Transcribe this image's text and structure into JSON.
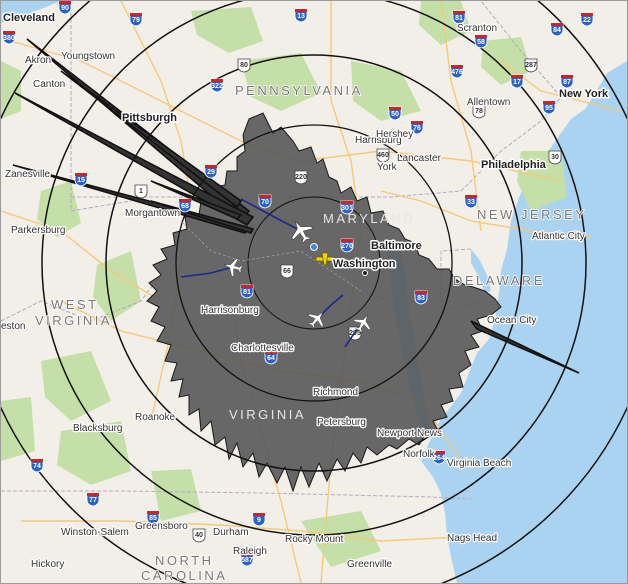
{
  "map": {
    "center_label": "Washington",
    "cities": [
      {
        "id": "cleveland",
        "name": "Cleveland",
        "major": true
      },
      {
        "id": "akron",
        "name": "Akron",
        "major": false
      },
      {
        "id": "youngstown",
        "name": "Youngstown",
        "major": false
      },
      {
        "id": "canton",
        "name": "Canton",
        "major": false
      },
      {
        "id": "pittsburgh",
        "name": "Pittsburgh",
        "major": true
      },
      {
        "id": "zanesville",
        "name": "Zanesville",
        "major": false
      },
      {
        "id": "morgantown",
        "name": "Morgantown",
        "major": false
      },
      {
        "id": "parkersburg",
        "name": "Parkersburg",
        "major": false
      },
      {
        "id": "scranton",
        "name": "Scranton",
        "major": false
      },
      {
        "id": "allentown",
        "name": "Allentown",
        "major": false
      },
      {
        "id": "new-york",
        "name": "New York",
        "major": true
      },
      {
        "id": "harrisburg",
        "name": "Harrisburg",
        "major": false
      },
      {
        "id": "hershey",
        "name": "Hershey",
        "major": false
      },
      {
        "id": "lancaster",
        "name": "Lancaster",
        "major": false
      },
      {
        "id": "york",
        "name": "York",
        "major": false
      },
      {
        "id": "philadelphia",
        "name": "Philadelphia",
        "major": true
      },
      {
        "id": "baltimore",
        "name": "Baltimore",
        "major": true
      },
      {
        "id": "washington",
        "name": "Washington",
        "major": true
      },
      {
        "id": "atlantic-city",
        "name": "Atlantic City",
        "major": false
      },
      {
        "id": "ocean-city",
        "name": "Ocean City",
        "major": false
      },
      {
        "id": "harrisonburg",
        "name": "Harrisonburg",
        "major": false
      },
      {
        "id": "charlottesville",
        "name": "Charlottesville",
        "major": false
      },
      {
        "id": "richmond",
        "name": "Richmond",
        "major": false
      },
      {
        "id": "petersburg",
        "name": "Petersburg",
        "major": false
      },
      {
        "id": "roanoke",
        "name": "Roanoke",
        "major": false
      },
      {
        "id": "blacksburg",
        "name": "Blacksburg",
        "major": false
      },
      {
        "id": "newport-news",
        "name": "Newport News",
        "major": false
      },
      {
        "id": "norfolk",
        "name": "Norfolk",
        "major": false
      },
      {
        "id": "virginia-beach",
        "name": "Virginia Beach",
        "major": false
      },
      {
        "id": "winston-salem",
        "name": "Winston-Salem",
        "major": false
      },
      {
        "id": "greensboro",
        "name": "Greensboro",
        "major": false
      },
      {
        "id": "durham",
        "name": "Durham",
        "major": false
      },
      {
        "id": "raleigh",
        "name": "Raleigh",
        "major": false
      },
      {
        "id": "rocky-mount",
        "name": "Rocky Mount",
        "major": false
      },
      {
        "id": "greenville",
        "name": "Greenville",
        "major": false
      },
      {
        "id": "hickory",
        "name": "Hickory",
        "major": false
      },
      {
        "id": "nags-head",
        "name": "Nags Head",
        "major": false
      },
      {
        "id": "charleston-partial",
        "name": "eston",
        "major": false
      }
    ],
    "states": [
      {
        "id": "pennsylvania",
        "name": "PENNSYLVANIA"
      },
      {
        "id": "maryland",
        "name": "MARYLAND"
      },
      {
        "id": "new-jersey",
        "name": "NEW JERSEY"
      },
      {
        "id": "delaware",
        "name": "DELAWARE"
      },
      {
        "id": "west-virginia-1",
        "name": "WEST"
      },
      {
        "id": "west-virginia-2",
        "name": "VIRGINIA"
      },
      {
        "id": "virginia",
        "name": "VIRGINIA"
      },
      {
        "id": "north-carolina-1",
        "name": "NORTH"
      },
      {
        "id": "north-carolina-2",
        "name": "CAROLINA"
      }
    ],
    "highways": [
      "90",
      "79",
      "380",
      "80",
      "81",
      "76",
      "476",
      "78",
      "95",
      "84",
      "87",
      "287",
      "68",
      "270",
      "70",
      "66",
      "64",
      "81",
      "85",
      "40",
      "587",
      "77",
      "74",
      "295",
      "264",
      "15",
      "29",
      "220",
      "58",
      "13",
      "17",
      "460",
      "50",
      "301",
      "83",
      "30",
      "22",
      "322",
      "33",
      "1",
      "9",
      "40"
    ],
    "aircraft_count": 6,
    "colors": {
      "water": "#aad3f2",
      "land": "#f2efe9",
      "forest": "#c5dfa8",
      "coverage": "#545454",
      "rings": "#1a1a1a",
      "interstate": "#2b62c5",
      "us_route": "#ffffff",
      "receiver": "#f2d40e"
    }
  }
}
